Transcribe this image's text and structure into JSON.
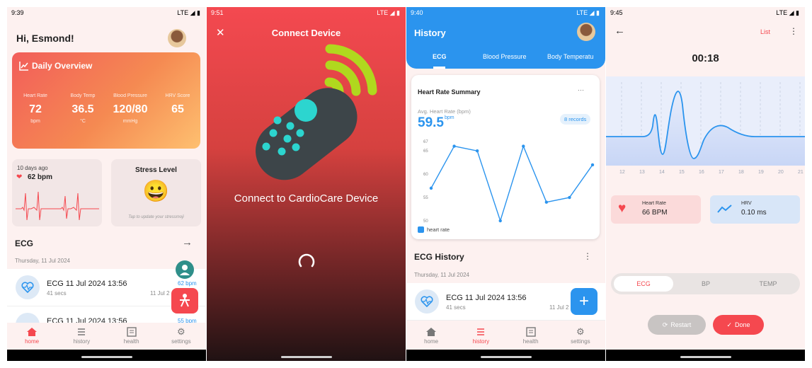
{
  "screen1": {
    "status": {
      "time": "9:39",
      "network": "LTE ◢ ▮"
    },
    "greeting": "Hi, Esmond!",
    "overview": {
      "title": "Daily Overview",
      "metrics": [
        {
          "label": "Heart Rate",
          "value": "72",
          "unit": "bpm"
        },
        {
          "label": "Body Temp",
          "value": "36.5",
          "unit": "°C"
        },
        {
          "label": "Blood Pressure",
          "value": "120/80",
          "unit": "mmHg"
        },
        {
          "label": "HRV Score",
          "value": "65",
          "unit": ""
        }
      ]
    },
    "hr_card": {
      "ago": "10 days ago",
      "bpm": "62 bpm"
    },
    "stress_card": {
      "title": "Stress Level",
      "emoji": "😀",
      "hint": "Tap to update your stressmoji"
    },
    "ecg_section": {
      "title": "ECG",
      "date": "Thursday, 11 Jul 2024"
    },
    "rows": [
      {
        "title": "ECG 11 Jul 2024 13:56",
        "sub": "41 secs",
        "date": "11 Jul 2",
        "bpm": "62 bpm"
      },
      {
        "title": "ECG 11 Jul 2024 13:56",
        "sub": "",
        "date": "",
        "bpm": "55 bpm"
      }
    ],
    "nav": [
      "home",
      "history",
      "health",
      "settings"
    ]
  },
  "screen2": {
    "status": {
      "time": "9:51",
      "network": "LTE ◢ ▮"
    },
    "title": "Connect Device",
    "message": "Connect to CardioCare Device"
  },
  "screen3": {
    "status": {
      "time": "9:40",
      "network": "LTE ◢ ▮"
    },
    "title": "History",
    "tabs": [
      "ECG",
      "Blood Pressure",
      "Body Temperatu"
    ],
    "summary": {
      "title": "Heart Rate Summary",
      "avg_label": "Avg. Heart Rate (bpm)",
      "avg_value": "59.5",
      "avg_unit": "bpm",
      "records": "8 records",
      "legend": "heart rate",
      "menu": "···"
    },
    "history": {
      "title": "ECG History",
      "date": "Thursday, 11 Jul 2024"
    },
    "row": {
      "title": "ECG 11 Jul 2024 13:56",
      "sub": "41 secs",
      "date": "11 Jul 2"
    },
    "nav": [
      "home",
      "history",
      "health",
      "settings"
    ]
  },
  "screen4": {
    "status": {
      "time": "9:45",
      "network": "LTE ◢ ▮"
    },
    "list_label": "List",
    "timer": "00:18",
    "xticks": [
      "12",
      "13",
      "14",
      "15",
      "16",
      "17",
      "18",
      "19",
      "20",
      "21"
    ],
    "heart_rate": {
      "label": "Heart Rate",
      "value": "66 BPM"
    },
    "hrv": {
      "label": "HRV",
      "value": "0.10 ms"
    },
    "segments": [
      "ECG",
      "BP",
      "TEMP"
    ],
    "restart": "Restart",
    "done": "Done"
  },
  "chart_data": {
    "type": "line",
    "x": [
      1,
      2,
      3,
      4,
      5,
      6,
      7,
      8
    ],
    "series": [
      {
        "name": "heart rate",
        "values": [
          57,
          66,
          65,
          50,
          66,
          54,
          55,
          62
        ]
      }
    ],
    "yticks": [
      "67",
      "65",
      "60",
      "55",
      "50"
    ],
    "ylim": [
      50,
      67
    ],
    "grid": false,
    "legend": "bottom-left"
  },
  "colors": {
    "accent_red": "#f5484f",
    "accent_blue": "#2b94ee"
  }
}
